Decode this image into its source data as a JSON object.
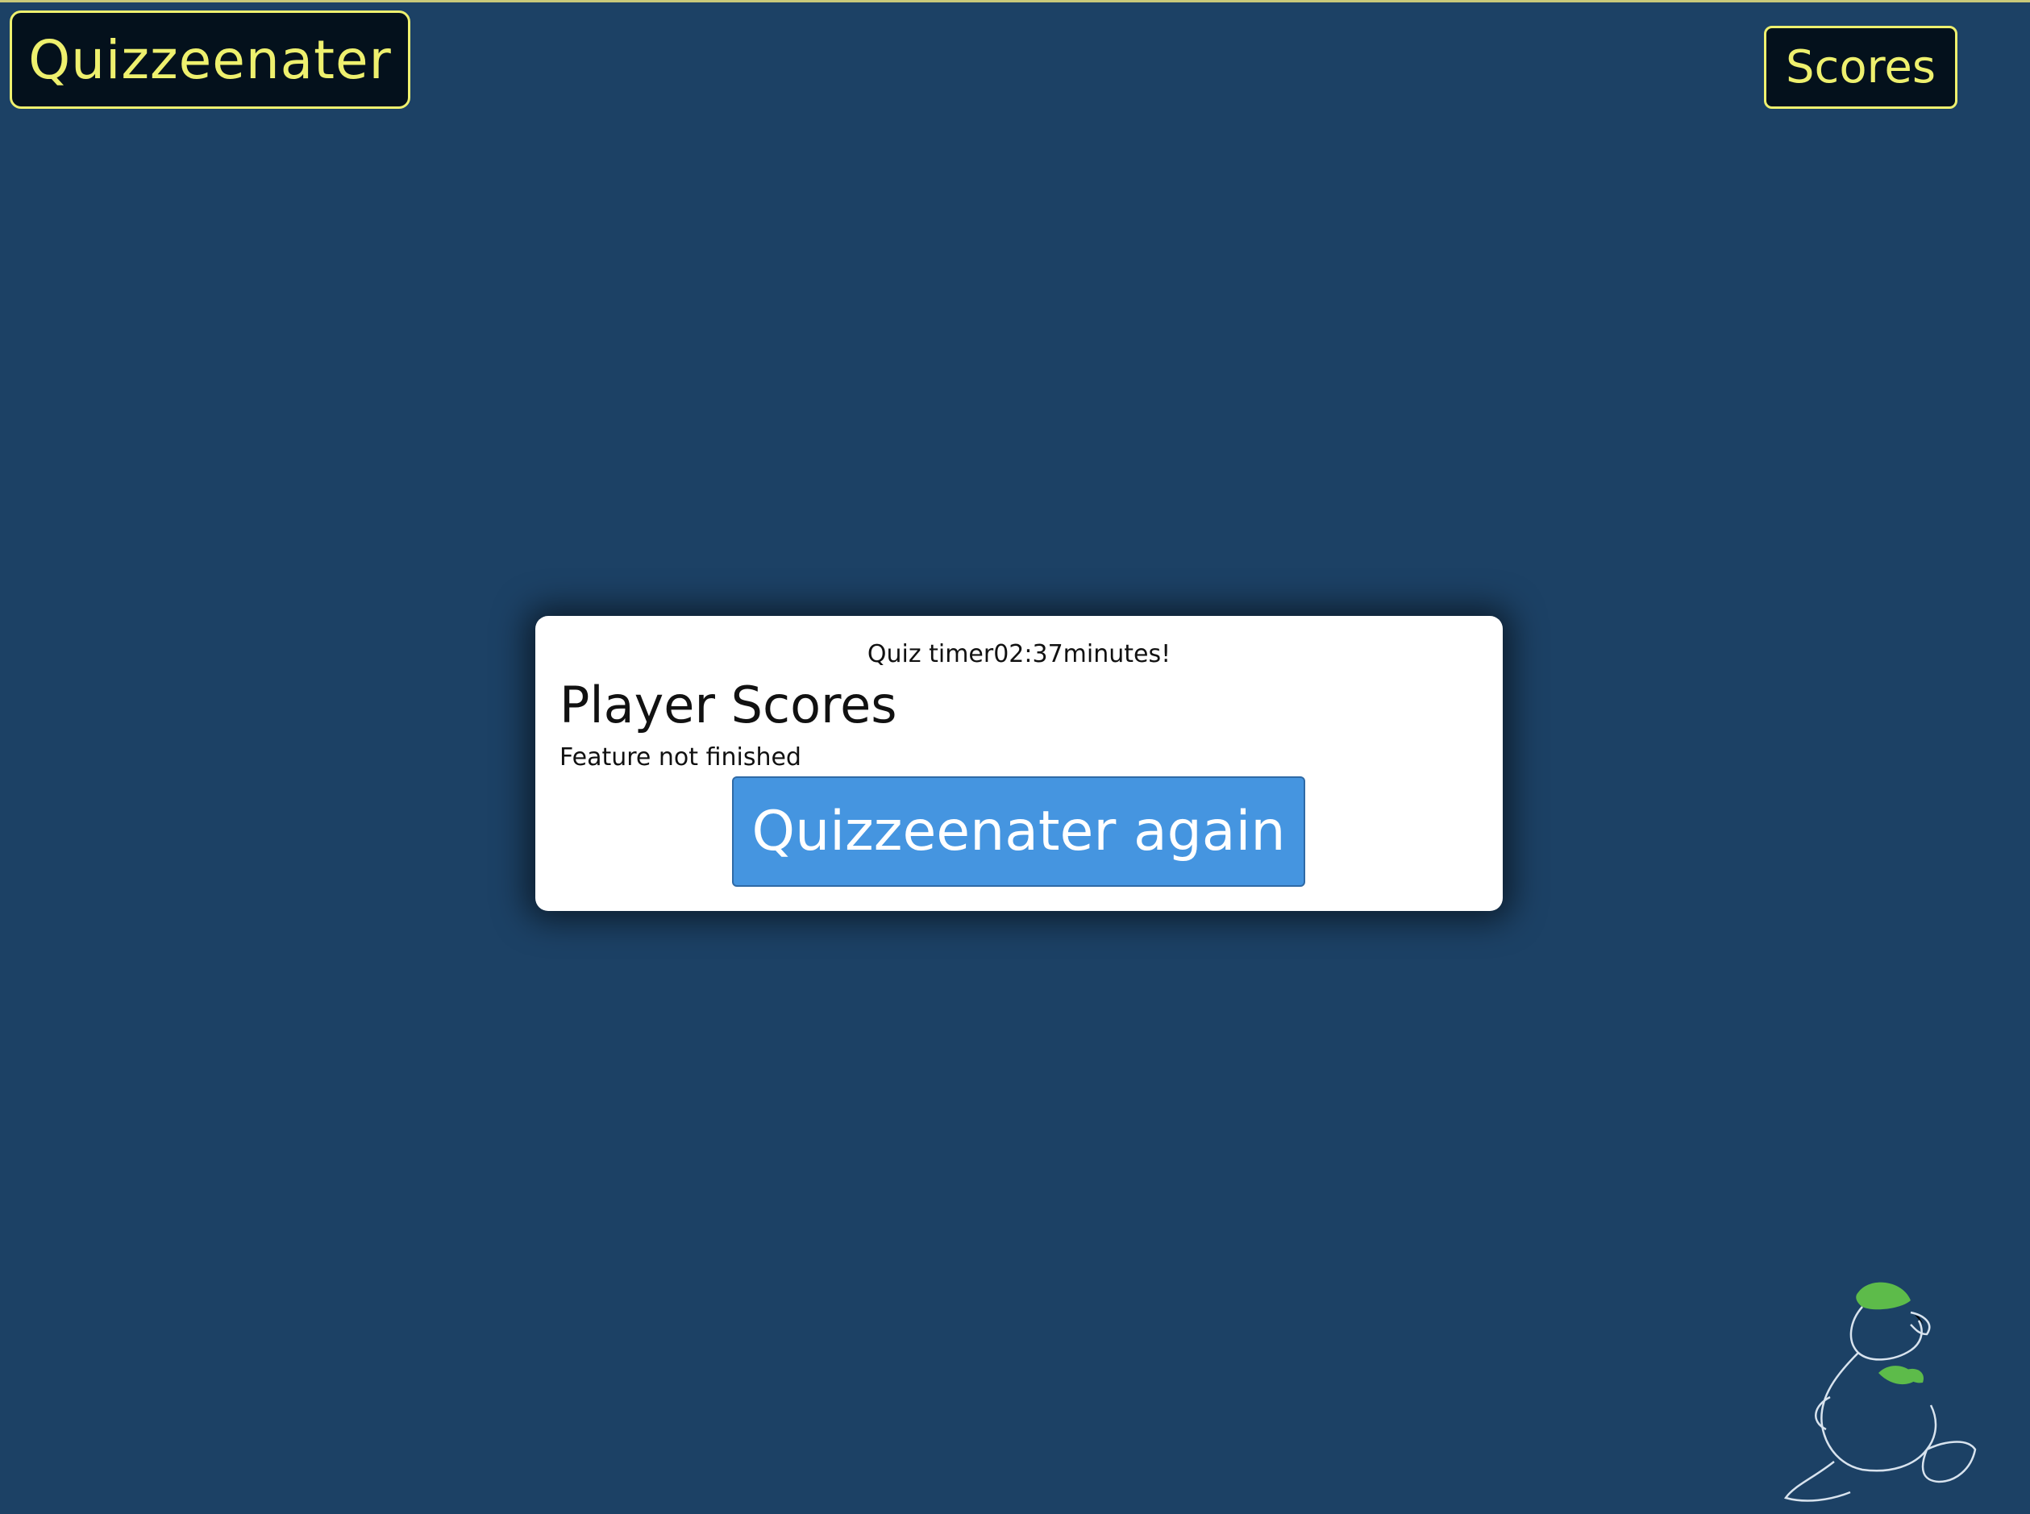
{
  "header": {
    "brand_label": "Quizzeenater",
    "scores_label": "Scores"
  },
  "modal": {
    "timer_text": "Quiz timer02:37minutes!",
    "title": "Player Scores",
    "subtitle": "Feature not finished",
    "again_label": "Quizzeenater again"
  },
  "colors": {
    "background": "#1c4165",
    "accent": "#eef06e",
    "button": "#4595e0",
    "mascot_hat": "#5dbb4a"
  },
  "icons": {
    "mascot": "duck-mascot-icon"
  }
}
